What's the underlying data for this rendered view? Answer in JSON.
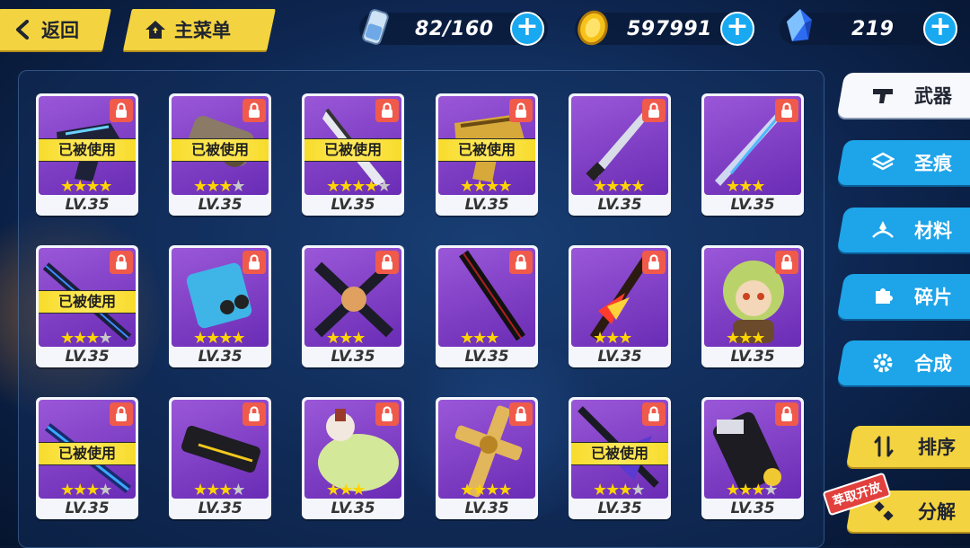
{
  "header": {
    "back_label": "返回",
    "home_label": "主菜单"
  },
  "resources": {
    "stamina": "82/160",
    "coins": "597991",
    "crystals": "219"
  },
  "tabs": [
    {
      "label": "武器",
      "icon": "gun-icon",
      "active": true
    },
    {
      "label": "圣痕",
      "icon": "stigmata-icon",
      "active": false
    },
    {
      "label": "材料",
      "icon": "material-icon",
      "active": false
    },
    {
      "label": "碎片",
      "icon": "puzzle-icon",
      "active": false
    },
    {
      "label": "合成",
      "icon": "gear-icon",
      "active": false
    }
  ],
  "actions": {
    "sort_label": "排序",
    "dismantle_label": "分解",
    "dismantle_badge": "萃取开放"
  },
  "colors": {
    "accent_yellow": "#f3d33f",
    "accent_blue": "#1ea4e8",
    "card_purple": "#7a3bc6"
  },
  "items": [
    {
      "level": "LV.35",
      "stars": 4,
      "max_stars": 4,
      "equipped": true,
      "used_label": "已被使用",
      "weapon": "pistol-icon"
    },
    {
      "level": "LV.35",
      "stars": 3,
      "max_stars": 4,
      "equipped": true,
      "used_label": "已被使用",
      "weapon": "cannon-icon"
    },
    {
      "level": "LV.35",
      "stars": 4,
      "max_stars": 5,
      "equipped": true,
      "used_label": "已被使用",
      "weapon": "blade-icon"
    },
    {
      "level": "LV.35",
      "stars": 4,
      "max_stars": 4,
      "equipped": true,
      "used_label": "已被使用",
      "weapon": "gold-pistol-icon"
    },
    {
      "level": "LV.35",
      "stars": 4,
      "max_stars": 4,
      "equipped": false,
      "used_label": "",
      "weapon": "katana-icon"
    },
    {
      "level": "LV.35",
      "stars": 3,
      "max_stars": 3,
      "equipped": false,
      "used_label": "",
      "weapon": "lance-icon"
    },
    {
      "level": "LV.35",
      "stars": 3,
      "max_stars": 4,
      "equipped": true,
      "used_label": "已被使用",
      "weapon": "staff-icon"
    },
    {
      "level": "LV.35",
      "stars": 4,
      "max_stars": 4,
      "equipped": false,
      "used_label": "",
      "weapon": "gauntlet-icon"
    },
    {
      "level": "LV.35",
      "stars": 3,
      "max_stars": 3,
      "equipped": false,
      "used_label": "",
      "weapon": "cross-blade-icon"
    },
    {
      "level": "LV.35",
      "stars": 3,
      "max_stars": 3,
      "equipped": false,
      "used_label": "",
      "weapon": "dark-katana-icon"
    },
    {
      "level": "LV.35",
      "stars": 3,
      "max_stars": 3,
      "equipped": false,
      "used_label": "",
      "weapon": "flame-sword-icon"
    },
    {
      "level": "LV.35",
      "stars": 3,
      "max_stars": 3,
      "equipped": false,
      "used_label": "",
      "weapon": "plush-doll-icon"
    },
    {
      "level": "LV.35",
      "stars": 3,
      "max_stars": 4,
      "equipped": true,
      "used_label": "已被使用",
      "weapon": "blue-sword-icon"
    },
    {
      "level": "LV.35",
      "stars": 3,
      "max_stars": 4,
      "equipped": false,
      "used_label": "",
      "weapon": "rifle-icon"
    },
    {
      "level": "LV.35",
      "stars": 3,
      "max_stars": 3,
      "equipped": false,
      "used_label": "",
      "weapon": "cushion-icon"
    },
    {
      "level": "LV.35",
      "stars": 4,
      "max_stars": 4,
      "equipped": false,
      "used_label": "",
      "weapon": "golden-cross-icon"
    },
    {
      "level": "LV.35",
      "stars": 3,
      "max_stars": 4,
      "equipped": true,
      "used_label": "已被使用",
      "weapon": "scythe-icon"
    },
    {
      "level": "LV.35",
      "stars": 3,
      "max_stars": 4,
      "equipped": false,
      "used_label": "",
      "weapon": "launcher-icon"
    }
  ]
}
